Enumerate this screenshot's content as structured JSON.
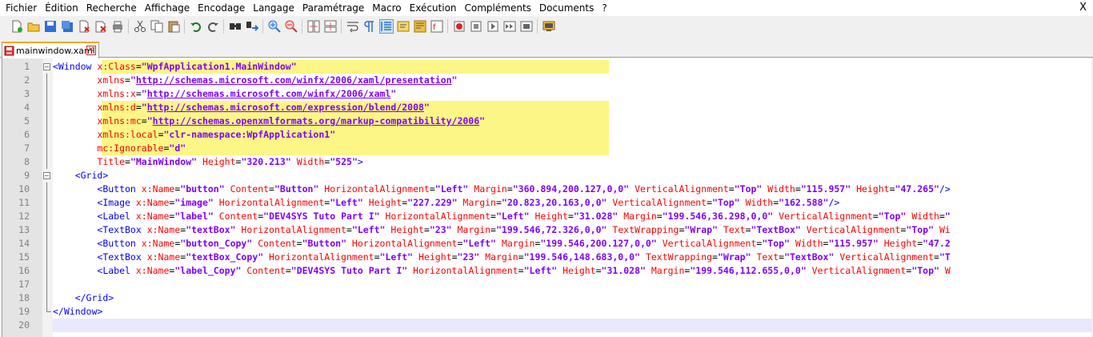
{
  "menu": [
    "Fichier",
    "Édition",
    "Recherche",
    "Affichage",
    "Encodage",
    "Langage",
    "Paramétrage",
    "Macro",
    "Exécution",
    "Compléments",
    "Documents",
    "?"
  ],
  "close_label": "X",
  "toolbar_icons": [
    "new-file-icon",
    "open-file-icon",
    "save-icon",
    "save-all-icon",
    "close-file-icon",
    "close-all-icon",
    "print-icon",
    "|",
    "cut-icon",
    "copy-icon",
    "paste-icon",
    "|",
    "undo-icon",
    "redo-icon",
    "|",
    "find-icon",
    "replace-icon",
    "|",
    "zoom-in-icon",
    "zoom-out-icon",
    "|",
    "sync-vertical-icon",
    "sync-horizontal-icon",
    "|",
    "word-wrap-icon",
    "show-all-chars-icon",
    "indent-guide-icon",
    "user-language-icon",
    "doc-map-icon",
    "function-list-icon",
    "|",
    "record-macro-icon",
    "stop-macro-icon",
    "play-macro-icon",
    "run-macro-multiple-icon",
    "save-macro-icon",
    "|",
    "monitor-icon"
  ],
  "tab": {
    "label": "mainwindow.xaml",
    "close": "✕"
  },
  "colors": {
    "tag": "#0000ff",
    "attr": "#ff0000",
    "value": "#8000ff",
    "highlight": "#fbf685"
  },
  "lines": [
    {
      "n": "1",
      "segs": [
        [
          "tag",
          "<Window "
        ],
        [
          "attr",
          "x:Class"
        ],
        [
          "plain",
          "="
        ],
        [
          "val",
          "\"WpfApplication1.MainWindow\""
        ]
      ],
      "hl": true
    },
    {
      "n": "2",
      "segs": [
        [
          "plain",
          "        "
        ],
        [
          "attr",
          "xmlns"
        ],
        [
          "plain",
          "="
        ],
        [
          "val",
          "\""
        ],
        [
          "url",
          "http://schemas.microsoft.com/winfx/2006/xaml/presentation"
        ],
        [
          "val",
          "\""
        ]
      ]
    },
    {
      "n": "3",
      "segs": [
        [
          "plain",
          "        "
        ],
        [
          "attr",
          "xmlns:x"
        ],
        [
          "plain",
          "="
        ],
        [
          "val",
          "\""
        ],
        [
          "url",
          "http://schemas.microsoft.com/winfx/2006/xaml"
        ],
        [
          "val",
          "\""
        ]
      ]
    },
    {
      "n": "4",
      "segs": [
        [
          "plain",
          "        "
        ],
        [
          "attr",
          "xmlns:d"
        ],
        [
          "plain",
          "="
        ],
        [
          "val",
          "\""
        ],
        [
          "url",
          "http://schemas.microsoft.com/expression/blend/2008"
        ],
        [
          "val",
          "\""
        ]
      ],
      "hl": true
    },
    {
      "n": "5",
      "segs": [
        [
          "plain",
          "        "
        ],
        [
          "attr",
          "xmlns:mc"
        ],
        [
          "plain",
          "="
        ],
        [
          "val",
          "\""
        ],
        [
          "url",
          "http://schemas.openxmlformats.org/markup-compatibility/2006"
        ],
        [
          "val",
          "\""
        ]
      ],
      "hl": true
    },
    {
      "n": "6",
      "segs": [
        [
          "plain",
          "        "
        ],
        [
          "attr",
          "xmlns:local"
        ],
        [
          "plain",
          "="
        ],
        [
          "val",
          "\"clr-namespace:WpfApplication1\""
        ]
      ],
      "hl": true
    },
    {
      "n": "7",
      "segs": [
        [
          "plain",
          "        "
        ],
        [
          "attr",
          "mc:Ignorable"
        ],
        [
          "plain",
          "="
        ],
        [
          "val",
          "\"d\""
        ]
      ],
      "hl": true
    },
    {
      "n": "8",
      "segs": [
        [
          "plain",
          "        "
        ],
        [
          "attr",
          "Title"
        ],
        [
          "plain",
          "="
        ],
        [
          "val",
          "\"MainWindow\""
        ],
        [
          "attr",
          " Height"
        ],
        [
          "plain",
          "="
        ],
        [
          "val",
          "\"320.213\""
        ],
        [
          "attr",
          " Width"
        ],
        [
          "plain",
          "="
        ],
        [
          "val",
          "\"525\""
        ],
        [
          "tag",
          ">"
        ]
      ]
    },
    {
      "n": "9",
      "segs": [
        [
          "plain",
          "    "
        ],
        [
          "tag",
          "<Grid>"
        ]
      ]
    },
    {
      "n": "10",
      "segs": [
        [
          "plain",
          "        "
        ],
        [
          "tag",
          "<Button "
        ],
        [
          "attr",
          "x:Name"
        ],
        [
          "plain",
          "="
        ],
        [
          "val",
          "\"button\""
        ],
        [
          "attr",
          " Content"
        ],
        [
          "plain",
          "="
        ],
        [
          "val",
          "\"Button\""
        ],
        [
          "attr",
          " HorizontalAlignment"
        ],
        [
          "plain",
          "="
        ],
        [
          "val",
          "\"Left\""
        ],
        [
          "attr",
          " Margin"
        ],
        [
          "plain",
          "="
        ],
        [
          "val",
          "\"360.894,200.127,0,0\""
        ],
        [
          "attr",
          " VerticalAlignment"
        ],
        [
          "plain",
          "="
        ],
        [
          "val",
          "\"Top\""
        ],
        [
          "attr",
          " Width"
        ],
        [
          "plain",
          "="
        ],
        [
          "val",
          "\"115.957\""
        ],
        [
          "attr",
          " Height"
        ],
        [
          "plain",
          "="
        ],
        [
          "val",
          "\"47.265\""
        ],
        [
          "tag",
          "/>"
        ]
      ]
    },
    {
      "n": "11",
      "segs": [
        [
          "plain",
          "        "
        ],
        [
          "tag",
          "<Image "
        ],
        [
          "attr",
          "x:Name"
        ],
        [
          "plain",
          "="
        ],
        [
          "val",
          "\"image\""
        ],
        [
          "attr",
          " HorizontalAlignment"
        ],
        [
          "plain",
          "="
        ],
        [
          "val",
          "\"Left\""
        ],
        [
          "attr",
          " Height"
        ],
        [
          "plain",
          "="
        ],
        [
          "val",
          "\"227.229\""
        ],
        [
          "attr",
          " Margin"
        ],
        [
          "plain",
          "="
        ],
        [
          "val",
          "\"20.823,20.163,0,0\""
        ],
        [
          "attr",
          " VerticalAlignment"
        ],
        [
          "plain",
          "="
        ],
        [
          "val",
          "\"Top\""
        ],
        [
          "attr",
          " Width"
        ],
        [
          "plain",
          "="
        ],
        [
          "val",
          "\"162.588\""
        ],
        [
          "tag",
          "/>"
        ]
      ]
    },
    {
      "n": "12",
      "segs": [
        [
          "plain",
          "        "
        ],
        [
          "tag",
          "<Label "
        ],
        [
          "attr",
          "x:Name"
        ],
        [
          "plain",
          "="
        ],
        [
          "val",
          "\"label\""
        ],
        [
          "attr",
          " Content"
        ],
        [
          "plain",
          "="
        ],
        [
          "val",
          "\"DEV4SYS Tuto Part I\""
        ],
        [
          "attr",
          " HorizontalAlignment"
        ],
        [
          "plain",
          "="
        ],
        [
          "val",
          "\"Left\""
        ],
        [
          "attr",
          " Height"
        ],
        [
          "plain",
          "="
        ],
        [
          "val",
          "\"31.028\""
        ],
        [
          "attr",
          " Margin"
        ],
        [
          "plain",
          "="
        ],
        [
          "val",
          "\"199.546,36.298,0,0\""
        ],
        [
          "attr",
          " VerticalAlignment"
        ],
        [
          "plain",
          "="
        ],
        [
          "val",
          "\"Top\""
        ],
        [
          "attr",
          " Width"
        ],
        [
          "plain",
          "="
        ],
        [
          "val",
          "\""
        ]
      ]
    },
    {
      "n": "13",
      "segs": [
        [
          "plain",
          "        "
        ],
        [
          "tag",
          "<TextBox "
        ],
        [
          "attr",
          "x:Name"
        ],
        [
          "plain",
          "="
        ],
        [
          "val",
          "\"textBox\""
        ],
        [
          "attr",
          " HorizontalAlignment"
        ],
        [
          "plain",
          "="
        ],
        [
          "val",
          "\"Left\""
        ],
        [
          "attr",
          " Height"
        ],
        [
          "plain",
          "="
        ],
        [
          "val",
          "\"23\""
        ],
        [
          "attr",
          " Margin"
        ],
        [
          "plain",
          "="
        ],
        [
          "val",
          "\"199.546,72.326,0,0\""
        ],
        [
          "attr",
          " TextWrapping"
        ],
        [
          "plain",
          "="
        ],
        [
          "val",
          "\"Wrap\""
        ],
        [
          "attr",
          " Text"
        ],
        [
          "plain",
          "="
        ],
        [
          "val",
          "\"TextBox\""
        ],
        [
          "attr",
          " VerticalAlignment"
        ],
        [
          "plain",
          "="
        ],
        [
          "val",
          "\"Top\""
        ],
        [
          "attr",
          " Wi"
        ]
      ]
    },
    {
      "n": "14",
      "segs": [
        [
          "plain",
          "        "
        ],
        [
          "tag",
          "<Button "
        ],
        [
          "attr",
          "x:Name"
        ],
        [
          "plain",
          "="
        ],
        [
          "val",
          "\"button_Copy\""
        ],
        [
          "attr",
          " Content"
        ],
        [
          "plain",
          "="
        ],
        [
          "val",
          "\"Button\""
        ],
        [
          "attr",
          " HorizontalAlignment"
        ],
        [
          "plain",
          "="
        ],
        [
          "val",
          "\"Left\""
        ],
        [
          "attr",
          " Margin"
        ],
        [
          "plain",
          "="
        ],
        [
          "val",
          "\"199.546,200.127,0,0\""
        ],
        [
          "attr",
          " VerticalAlignment"
        ],
        [
          "plain",
          "="
        ],
        [
          "val",
          "\"Top\""
        ],
        [
          "attr",
          " Width"
        ],
        [
          "plain",
          "="
        ],
        [
          "val",
          "\"115.957\""
        ],
        [
          "attr",
          " Height"
        ],
        [
          "plain",
          "="
        ],
        [
          "val",
          "\"47.2"
        ]
      ]
    },
    {
      "n": "15",
      "segs": [
        [
          "plain",
          "        "
        ],
        [
          "tag",
          "<TextBox "
        ],
        [
          "attr",
          "x:Name"
        ],
        [
          "plain",
          "="
        ],
        [
          "val",
          "\"textBox_Copy\""
        ],
        [
          "attr",
          " HorizontalAlignment"
        ],
        [
          "plain",
          "="
        ],
        [
          "val",
          "\"Left\""
        ],
        [
          "attr",
          " Height"
        ],
        [
          "plain",
          "="
        ],
        [
          "val",
          "\"23\""
        ],
        [
          "attr",
          " Margin"
        ],
        [
          "plain",
          "="
        ],
        [
          "val",
          "\"199.546,148.683,0,0\""
        ],
        [
          "attr",
          " TextWrapping"
        ],
        [
          "plain",
          "="
        ],
        [
          "val",
          "\"Wrap\""
        ],
        [
          "attr",
          " Text"
        ],
        [
          "plain",
          "="
        ],
        [
          "val",
          "\"TextBox\""
        ],
        [
          "attr",
          " VerticalAlignment"
        ],
        [
          "plain",
          "="
        ],
        [
          "val",
          "\"T"
        ]
      ]
    },
    {
      "n": "16",
      "segs": [
        [
          "plain",
          "        "
        ],
        [
          "tag",
          "<Label "
        ],
        [
          "attr",
          "x:Name"
        ],
        [
          "plain",
          "="
        ],
        [
          "val",
          "\"label_Copy\""
        ],
        [
          "attr",
          " Content"
        ],
        [
          "plain",
          "="
        ],
        [
          "val",
          "\"DEV4SYS Tuto Part I\""
        ],
        [
          "attr",
          " HorizontalAlignment"
        ],
        [
          "plain",
          "="
        ],
        [
          "val",
          "\"Left\""
        ],
        [
          "attr",
          " Height"
        ],
        [
          "plain",
          "="
        ],
        [
          "val",
          "\"31.028\""
        ],
        [
          "attr",
          " Margin"
        ],
        [
          "plain",
          "="
        ],
        [
          "val",
          "\"199.546,112.655,0,0\""
        ],
        [
          "attr",
          " VerticalAlignment"
        ],
        [
          "plain",
          "="
        ],
        [
          "val",
          "\"Top\""
        ],
        [
          "attr",
          " W"
        ]
      ]
    },
    {
      "n": "17",
      "segs": []
    },
    {
      "n": "18",
      "segs": [
        [
          "plain",
          "    "
        ],
        [
          "tag",
          "</Grid>"
        ]
      ]
    },
    {
      "n": "19",
      "segs": [
        [
          "tag",
          "</Window>"
        ]
      ]
    },
    {
      "n": "20",
      "segs": [],
      "caret": true
    }
  ]
}
